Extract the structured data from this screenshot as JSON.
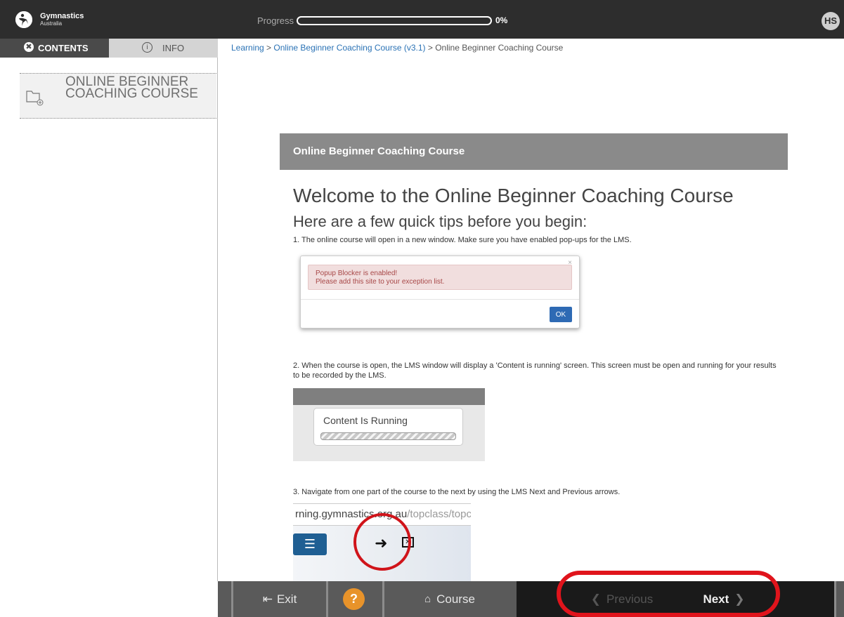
{
  "header": {
    "brand_name": "Gymnastics",
    "brand_sub": "Australia",
    "progress_label": "Progress",
    "progress_value": 0,
    "progress_text": "0%",
    "avatar_initials": "HS"
  },
  "tabs": {
    "contents_icon": "✖",
    "contents_label": "CONTENTS",
    "info_icon": "i",
    "info_label": "INFO"
  },
  "breadcrumb": {
    "item1": "Learning",
    "sep1": " > ",
    "item2": "Online Beginner Coaching Course (v3.1)",
    "sep2": " > ",
    "item3": "Online Beginner Coaching Course"
  },
  "sidebar": {
    "item_label": "ONLINE BEGINNER COACHING COURSE",
    "item_icon": "folder-add-icon"
  },
  "main": {
    "panel_title": "Online Beginner Coaching Course",
    "welcome": "Welcome to the Online Beginner Coaching Course",
    "tips_heading": "Here are a few quick tips before you begin:",
    "step1": "1. The online course will open in a new window. Make sure you have enabled pop-ups for the LMS.",
    "step2": "2. When the course is open, the LMS window will display a 'Content is running' screen. This screen must be open and running for your results to be recorded by the LMS.",
    "step3": "3. Navigate from one part of the course to the next by using the LMS Next and Previous arrows."
  },
  "popup": {
    "line1": "Popup Blocker is enabled!",
    "line2": "Please add this site to your exception list.",
    "close": "×",
    "ok": "OK"
  },
  "running": {
    "text": "Content Is Running"
  },
  "navshot": {
    "url_main": "rning.gymnastics.org.au",
    "url_dim": "/topclass/topc",
    "menu_glyph": "☰",
    "arrow_glyph": "➜",
    "stop_glyph": "✕"
  },
  "bottom": {
    "exit_icon": "⇤",
    "exit_label": "Exit",
    "help_label": "?",
    "course_icon": "⌂",
    "course_label": "Course",
    "prev_icon": "❮",
    "prev_label": "Previous",
    "next_label": "Next",
    "next_icon": "❯"
  },
  "colors": {
    "topbar": "#2d2d2d",
    "link": "#2a72b5",
    "help": "#e8932a",
    "highlight": "#e0141c"
  }
}
